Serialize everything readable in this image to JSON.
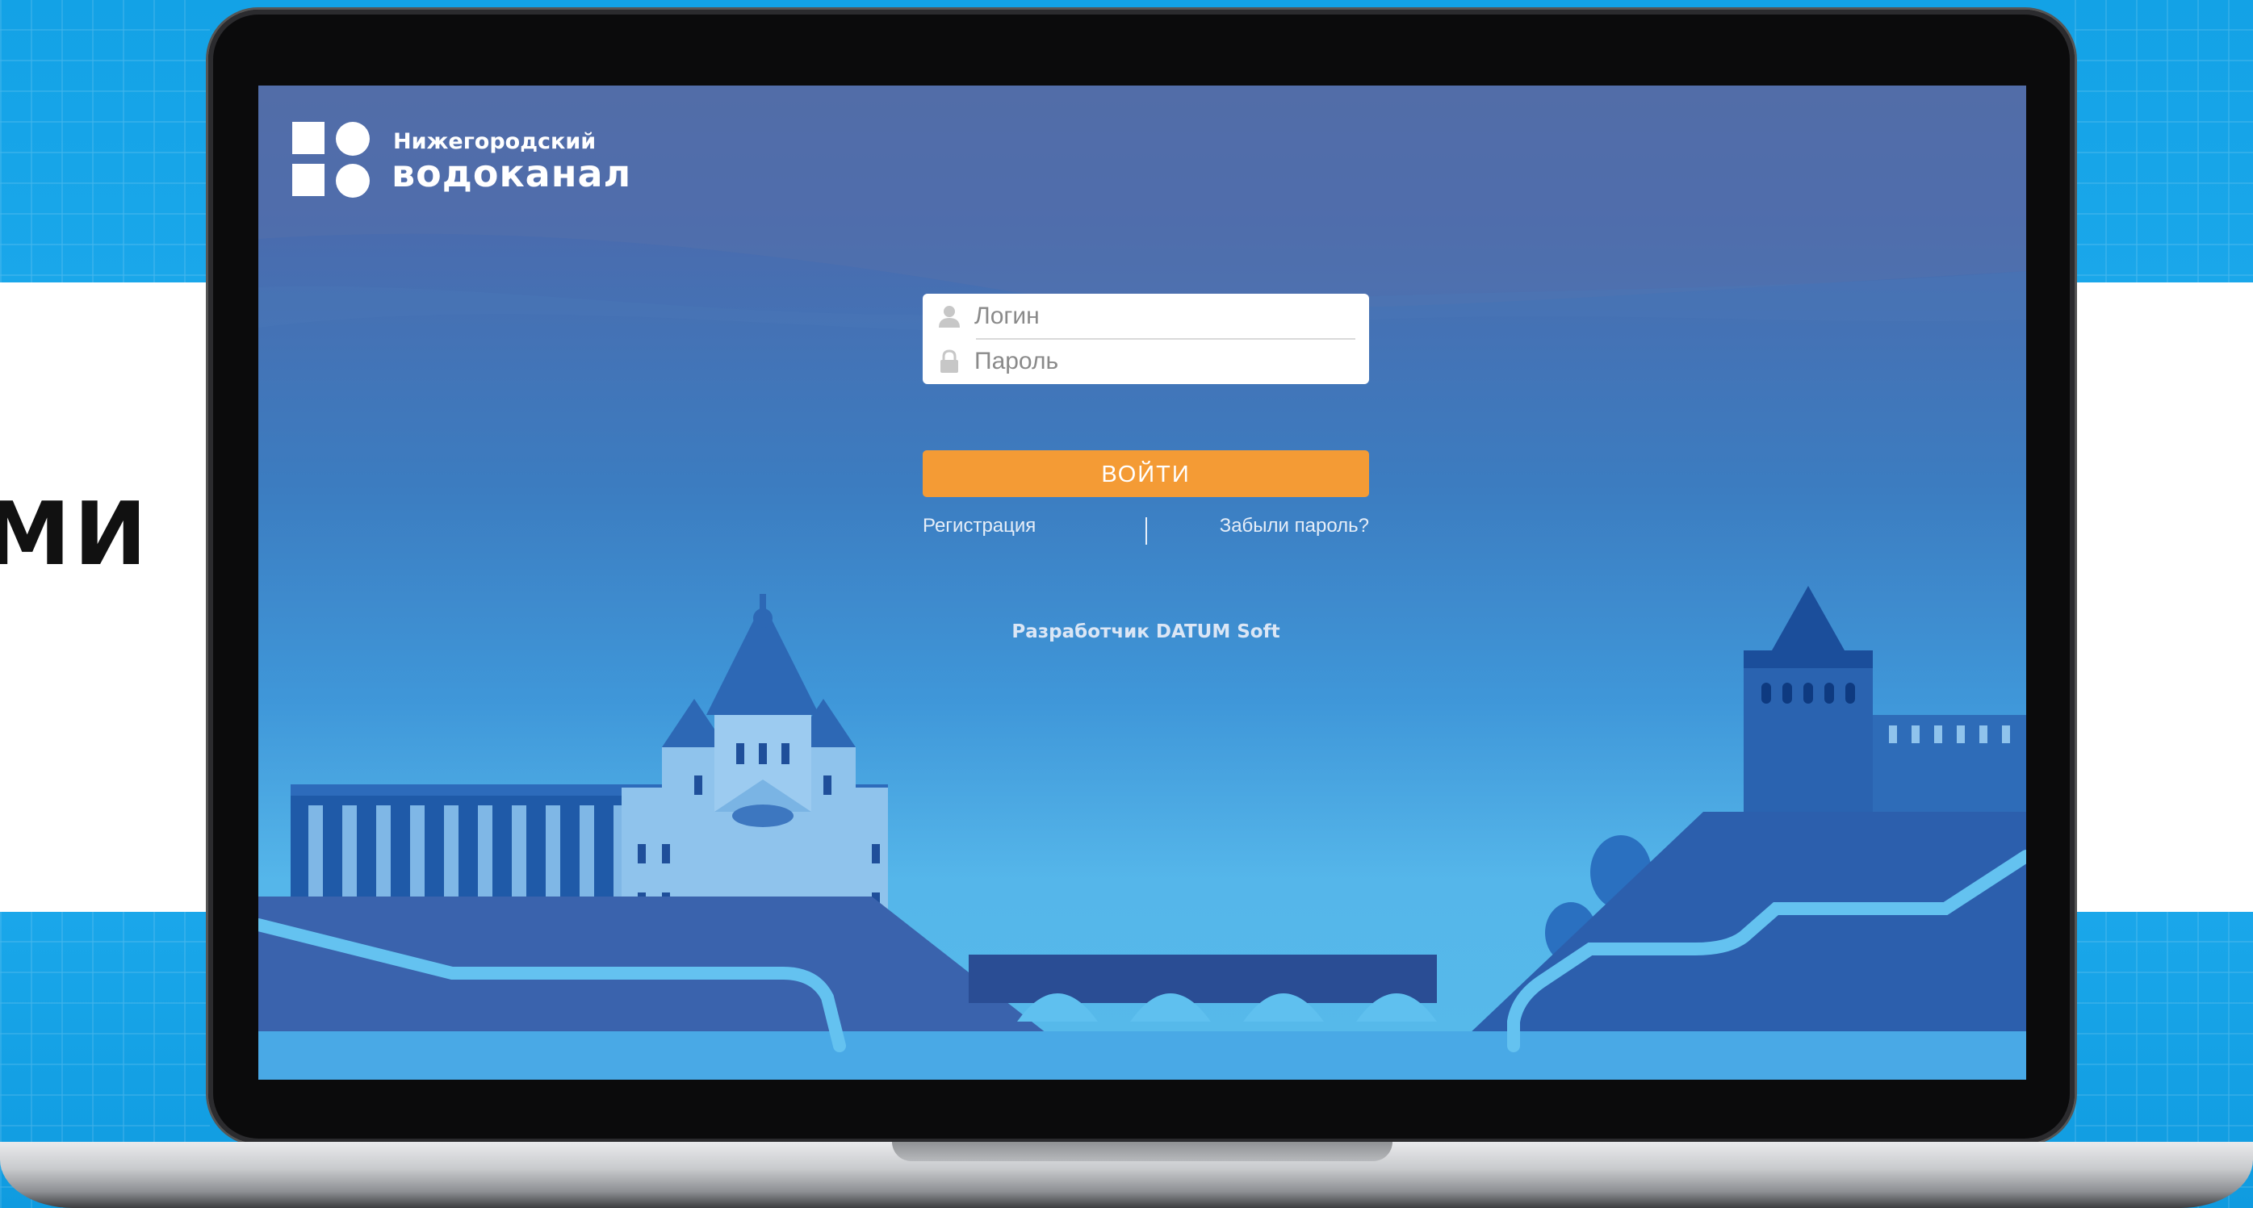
{
  "background": {
    "side_text": "МИ"
  },
  "logo": {
    "line1": "Нижегородский",
    "line2": "водоканал"
  },
  "login_form": {
    "login_placeholder": "Логин",
    "password_placeholder": "Пароль",
    "login_value": "",
    "password_value": "",
    "submit_label": "ВОЙТИ",
    "register_link": "Регистрация",
    "forgot_link": "Забыли пароль?"
  },
  "footer": {
    "developer_credit": "Разработчик DATUM Soft"
  },
  "colors": {
    "accent_button": "#f49b35",
    "screen_top": "#4f6aa6",
    "screen_bottom": "#56baea",
    "outer_band": "#13a2e6"
  },
  "icons": {
    "login_field": "user-icon",
    "password_field": "lock-icon"
  }
}
